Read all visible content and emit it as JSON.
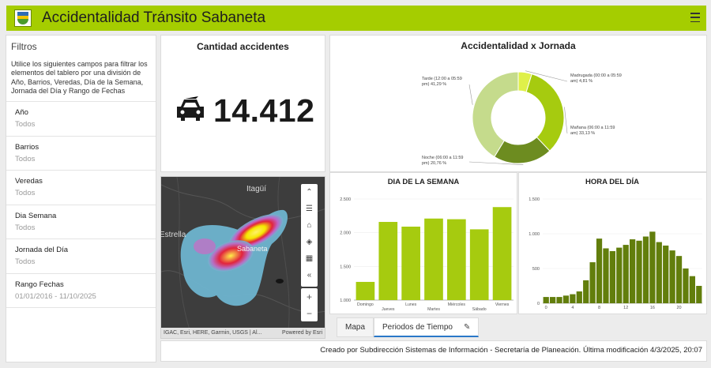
{
  "header": {
    "title": "Accidentalidad Tránsito Sabaneta",
    "logo_icon": "municipal-shield",
    "menu_icon": "hamburger-menu"
  },
  "filters": {
    "title": "Filtros",
    "description": "Utilice los siguientes campos para filtrar los elementos del tablero por una división de Año, Barrios, Veredas, Día de la Semana, Jornada del Día y Rango de Fechas",
    "items": [
      {
        "label": "Año",
        "value": "Todos"
      },
      {
        "label": "Barrios",
        "value": "Todos"
      },
      {
        "label": "Veredas",
        "value": "Todos"
      },
      {
        "label": "Dia Semana",
        "value": "Todos"
      },
      {
        "label": "Jornada del Día",
        "value": "Todos"
      },
      {
        "label": "Rango Fechas",
        "value": "01/01/2016 - 11/10/2025"
      }
    ]
  },
  "count": {
    "title": "Cantidad accidentes",
    "value": "14.412",
    "icon": "car-icon"
  },
  "map": {
    "labels": {
      "itagui": "Itagüí",
      "sabaneta": "Sabaneta",
      "estrella": "Estrella"
    },
    "attribution": "IGAC, Esri, HERE, Garmin, USGS | Al...",
    "powered": "Powered by Esri",
    "controls": [
      "chevron-up-icon",
      "list-icon",
      "home-icon",
      "layers-icon",
      "qr-icon",
      "collapse-icon"
    ],
    "zoom": {
      "in": "+",
      "out": "−"
    }
  },
  "tabs": {
    "items": [
      {
        "label": "Mapa"
      },
      {
        "label": "Periodos de Tiempo"
      }
    ],
    "active": 1,
    "edit_icon": "pencil-icon"
  },
  "chart_data": [
    {
      "type": "pie",
      "title": "Accidentalidad x Jornada",
      "donut": true,
      "slices": [
        {
          "label": "Madrugada (00:00 a 05:59 am)",
          "percent": 4.81,
          "text": "Madrugada (00:00 a 05:59 am) 4,81 %",
          "color": "#dff04a"
        },
        {
          "label": "Mañana (06:00 a 11:59 am)",
          "percent": 33.13,
          "text": "Mañana (06:00 a 11:59 am) 33,13 %",
          "color": "#a6cb0f"
        },
        {
          "label": "Noche (06:00 a 11:59 pm)",
          "percent": 20.76,
          "text": "Noche (06:00 a 11:59 pm) 20,76 %",
          "color": "#6d8c20"
        },
        {
          "label": "Tarde (12:00 a 05:59 pm)",
          "percent": 41.29,
          "text": "Tarde (12:00 a 05:59 pm) 41,29 %",
          "color": "#c5db8c"
        }
      ]
    },
    {
      "type": "bar",
      "title": "DIA DE LA SEMANA",
      "categories": [
        "Domingo",
        "Jueves",
        "Lunes",
        "Martes",
        "Miércoles",
        "Sábado",
        "Viernes"
      ],
      "values": [
        1270,
        2160,
        2090,
        2210,
        2200,
        2050,
        2380
      ],
      "ylim": [
        1000,
        2500
      ],
      "yticks": [
        "1.000",
        "1.500",
        "2.000",
        "2.500"
      ],
      "color": "#a6cb0f"
    },
    {
      "type": "bar",
      "title": "HORA DEL DÍA",
      "categories": [
        0,
        1,
        2,
        3,
        4,
        5,
        6,
        7,
        8,
        9,
        10,
        11,
        12,
        13,
        14,
        15,
        16,
        17,
        18,
        19,
        20,
        21,
        22,
        23
      ],
      "values": [
        90,
        90,
        90,
        110,
        130,
        170,
        330,
        590,
        930,
        790,
        750,
        800,
        840,
        920,
        900,
        960,
        1030,
        880,
        830,
        760,
        680,
        500,
        390,
        250
      ],
      "ylim": [
        0,
        1500
      ],
      "yticks": [
        "0",
        "500",
        "1.000",
        "1.500"
      ],
      "xticks": [
        "0",
        "4",
        "8",
        "12",
        "16",
        "20"
      ],
      "color": "#627e0c"
    }
  ],
  "footer": {
    "text": "Creado por Subdirección Sistemas de Información - Secretaría de Planeación. Última modificación 4/3/2025, 20:07"
  }
}
